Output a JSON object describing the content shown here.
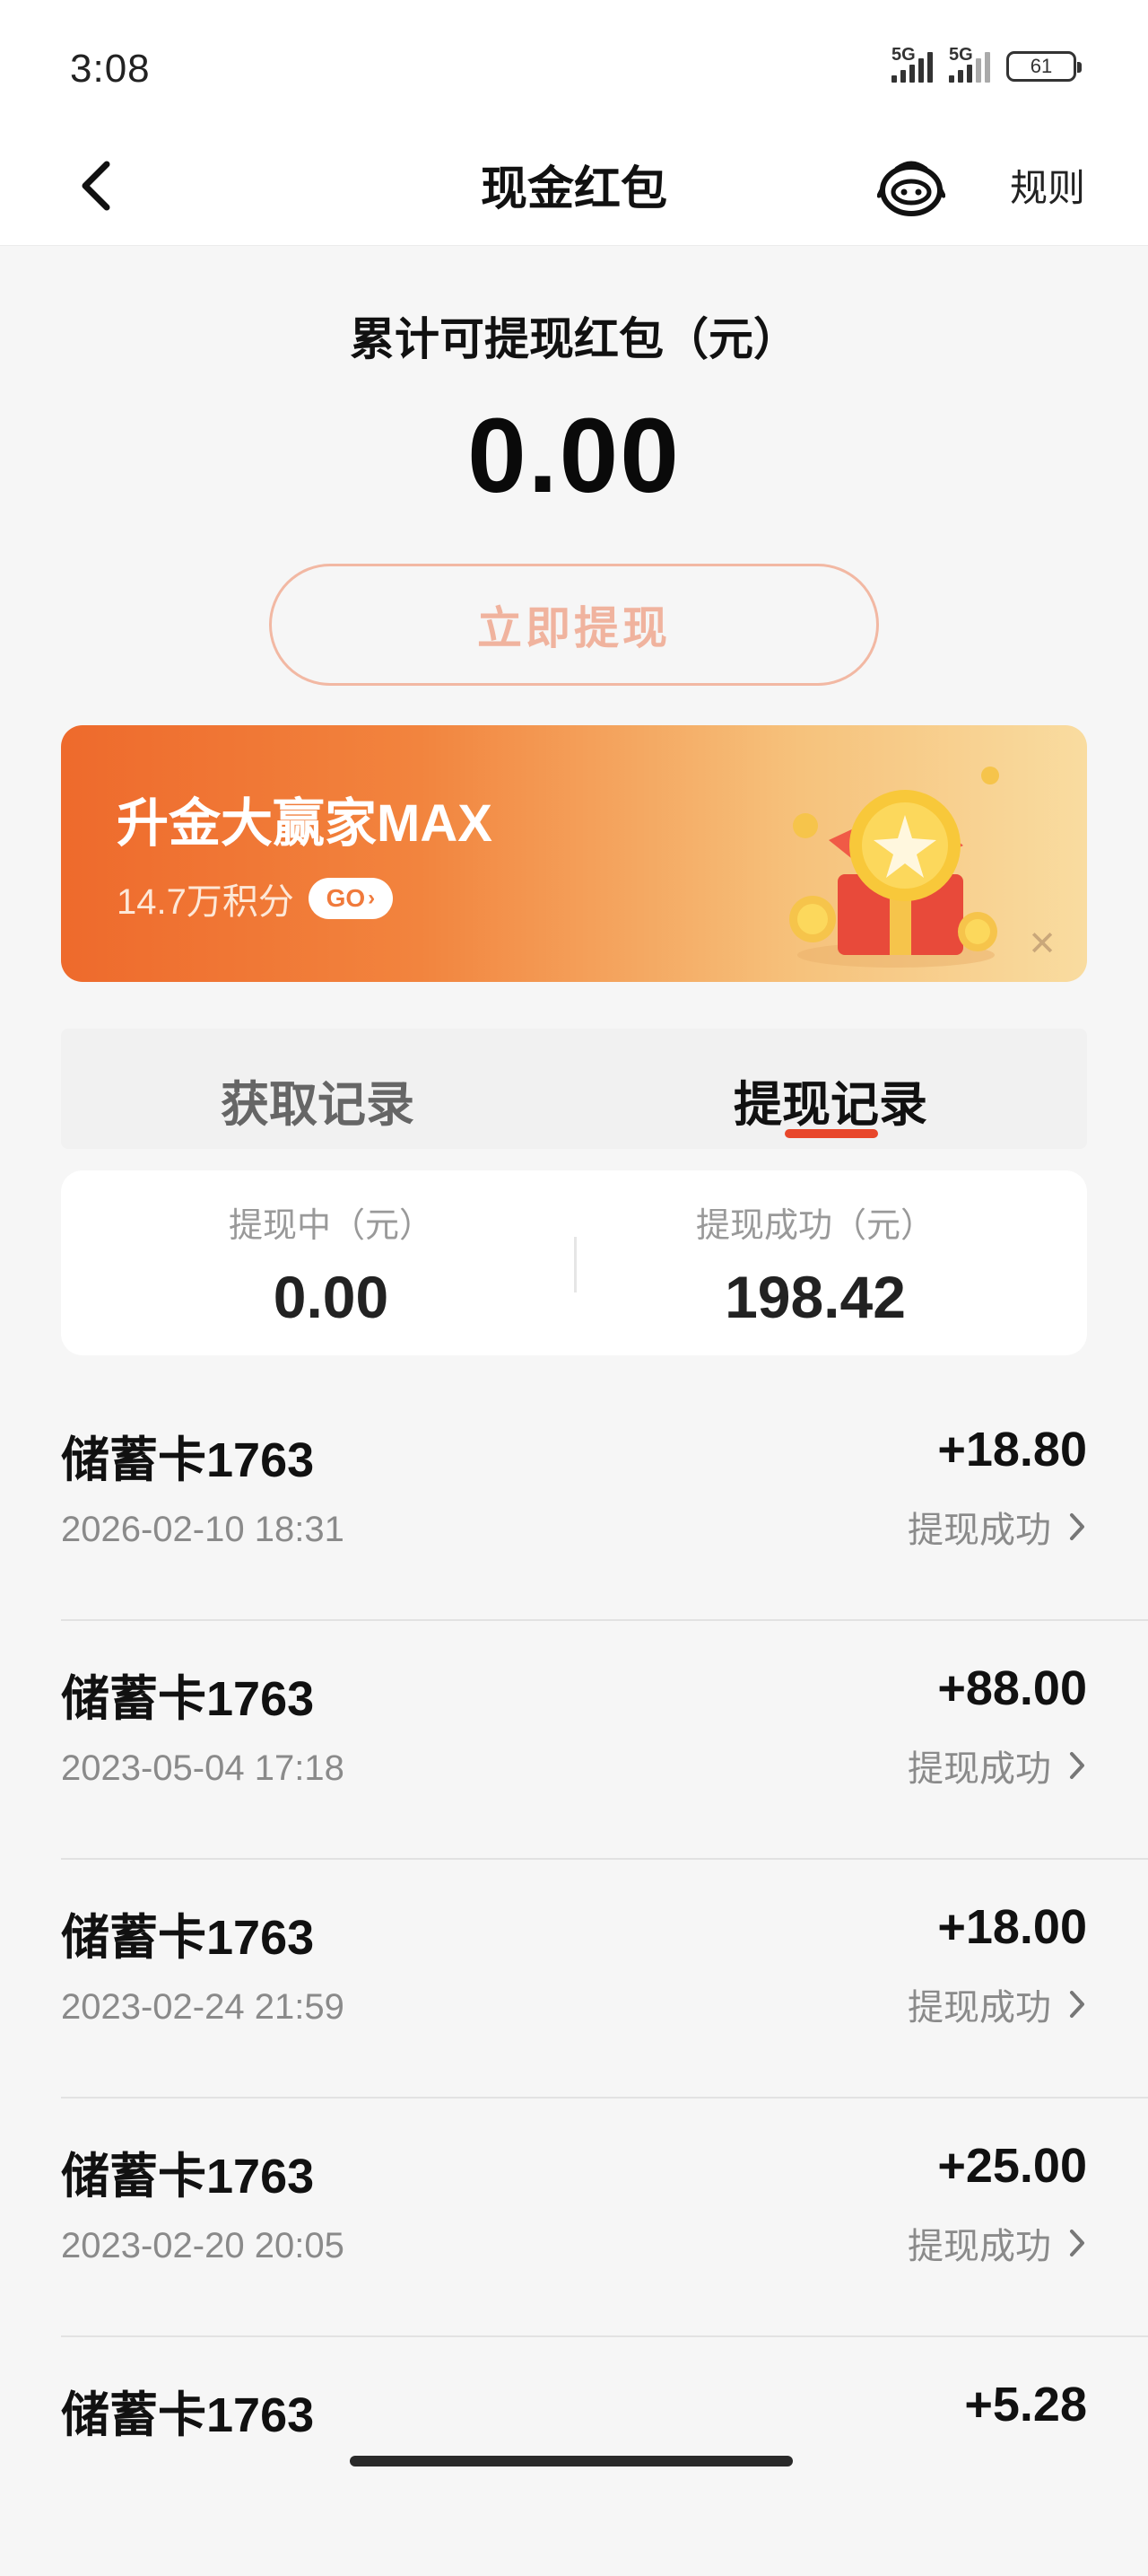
{
  "status_bar": {
    "time": "3:08",
    "network_1": "5G",
    "network_2": "5G",
    "battery": "61"
  },
  "nav": {
    "title": "现金红包",
    "rules_label": "规则",
    "back_icon": "chevron-left-icon",
    "service_icon": "robot-service-icon"
  },
  "hero": {
    "label": "累计可提现红包（元）",
    "amount": "0.00",
    "withdraw_button": "立即提现"
  },
  "promo": {
    "title": "升金大赢家MAX",
    "subtitle": "14.7万积分",
    "go_label": "GO",
    "close_icon": "close-icon",
    "gift_icon": "gift-box-icon"
  },
  "tabs": [
    {
      "label": "获取记录",
      "active": false
    },
    {
      "label": "提现记录",
      "active": true
    }
  ],
  "summary": {
    "pending_label": "提现中（元）",
    "pending_value": "0.00",
    "success_label": "提现成功（元）",
    "success_value": "198.42"
  },
  "records": [
    {
      "card": "储蓄卡1763",
      "date": "2026-02-10 18:31",
      "amount": "+18.80",
      "status": "提现成功"
    },
    {
      "card": "储蓄卡1763",
      "date": "2023-05-04 17:18",
      "amount": "+88.00",
      "status": "提现成功"
    },
    {
      "card": "储蓄卡1763",
      "date": "2023-02-24 21:59",
      "amount": "+18.00",
      "status": "提现成功"
    },
    {
      "card": "储蓄卡1763",
      "date": "2023-02-20 20:05",
      "amount": "+25.00",
      "status": "提现成功"
    },
    {
      "card": "储蓄卡1763",
      "date": "",
      "amount": "+5.28",
      "status": ""
    }
  ],
  "colors": {
    "accent": "#e8472b",
    "button_border": "#f2b8a3",
    "promo_start": "#ee6a2c",
    "promo_end": "#f9dca0"
  }
}
